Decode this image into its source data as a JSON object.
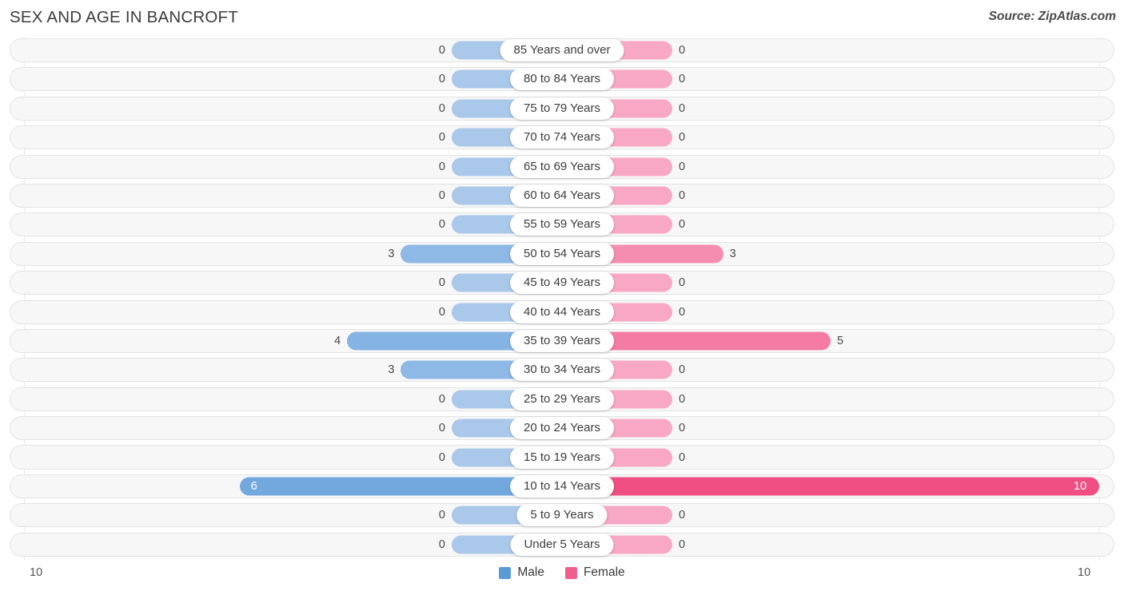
{
  "header": {
    "title": "SEX AND AGE IN BANCROFT",
    "source": "Source: ZipAtlas.com"
  },
  "legend": {
    "male_label": "Male",
    "female_label": "Female",
    "male_color": "#5b9bd5",
    "female_color": "#ef5e8c"
  },
  "axis": {
    "left_end": "10",
    "right_end": "10",
    "max": 10
  },
  "chart_data": {
    "type": "bar",
    "subtype": "population-pyramid",
    "title": "SEX AND AGE IN BANCROFT",
    "xlabel": "",
    "ylabel": "",
    "xlim": [
      10,
      10
    ],
    "grid": true,
    "legend_position": "bottom-center",
    "categories": [
      "85 Years and over",
      "80 to 84 Years",
      "75 to 79 Years",
      "70 to 74 Years",
      "65 to 69 Years",
      "60 to 64 Years",
      "55 to 59 Years",
      "50 to 54 Years",
      "45 to 49 Years",
      "40 to 44 Years",
      "35 to 39 Years",
      "30 to 34 Years",
      "25 to 29 Years",
      "20 to 24 Years",
      "15 to 19 Years",
      "10 to 14 Years",
      "5 to 9 Years",
      "Under 5 Years"
    ],
    "series": [
      {
        "name": "Male",
        "color": "#5b9bd5",
        "values": [
          0,
          0,
          0,
          0,
          0,
          0,
          0,
          3,
          0,
          0,
          4,
          3,
          0,
          0,
          0,
          6,
          0,
          0
        ]
      },
      {
        "name": "Female",
        "color": "#ef5e8c",
        "values": [
          0,
          0,
          0,
          0,
          0,
          0,
          0,
          3,
          0,
          0,
          5,
          0,
          0,
          0,
          0,
          10,
          0,
          0
        ]
      }
    ]
  },
  "rows": [
    {
      "label": "85 Years and over",
      "male": "0",
      "female": "0"
    },
    {
      "label": "80 to 84 Years",
      "male": "0",
      "female": "0"
    },
    {
      "label": "75 to 79 Years",
      "male": "0",
      "female": "0"
    },
    {
      "label": "70 to 74 Years",
      "male": "0",
      "female": "0"
    },
    {
      "label": "65 to 69 Years",
      "male": "0",
      "female": "0"
    },
    {
      "label": "60 to 64 Years",
      "male": "0",
      "female": "0"
    },
    {
      "label": "55 to 59 Years",
      "male": "0",
      "female": "0"
    },
    {
      "label": "50 to 54 Years",
      "male": "3",
      "female": "3"
    },
    {
      "label": "45 to 49 Years",
      "male": "0",
      "female": "0"
    },
    {
      "label": "40 to 44 Years",
      "male": "0",
      "female": "0"
    },
    {
      "label": "35 to 39 Years",
      "male": "4",
      "female": "5"
    },
    {
      "label": "30 to 34 Years",
      "male": "3",
      "female": "0"
    },
    {
      "label": "25 to 29 Years",
      "male": "0",
      "female": "0"
    },
    {
      "label": "20 to 24 Years",
      "male": "0",
      "female": "0"
    },
    {
      "label": "15 to 19 Years",
      "male": "0",
      "female": "0"
    },
    {
      "label": "10 to 14 Years",
      "male": "6",
      "female": "10"
    },
    {
      "label": "5 to 9 Years",
      "male": "0",
      "female": "0"
    },
    {
      "label": "Under 5 Years",
      "male": "0",
      "female": "0"
    }
  ]
}
